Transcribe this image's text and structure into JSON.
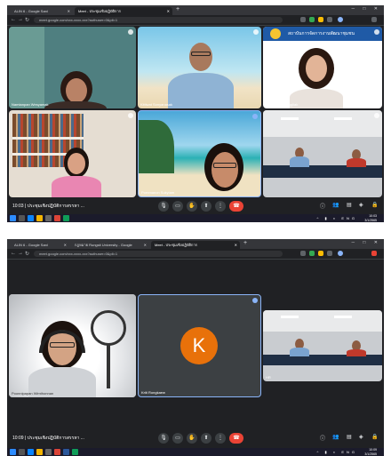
{
  "screenshot_1": {
    "tabs": [
      {
        "label": "ALIN 6 - Google Sanl",
        "active": false
      },
      {
        "label": "Meet - ประชุมเชิงปฏิบัติการ",
        "active": true
      }
    ],
    "url": "meet.google.com/xxx-xxxx-xxx?authuser=0&pli=1",
    "participants": [
      {
        "name": "Namtanpan Wesyamak"
      },
      {
        "name": "Kittiwat Sonyanasak"
      },
      {
        "name": "Pimkamol Konggliak"
      },
      {
        "name": ""
      },
      {
        "name": "Pornmanon Sukyiam"
      },
      {
        "name": ""
      }
    ],
    "banner_text": "สถาบันการจัดการงานพัฒนาชุมชน",
    "meeting_time": "10:03",
    "meeting_title": "ประชุมเชิงปฏิบัติการสรรหา ...",
    "clock": {
      "time": "10:03",
      "date": "3/1/2565"
    }
  },
  "screenshot_2": {
    "tabs": [
      {
        "label": "ALIN 6 - Google Sanl",
        "active": false
      },
      {
        "label": "กฎหมาย Rungsit University - Google",
        "active": false
      },
      {
        "label": "Meet - ประชุมเชิงปฏิบัติการ",
        "active": true
      }
    ],
    "url": "meet.google.com/xxx-xxxx-xxx?authuser=0&pli=1",
    "participants": [
      {
        "name": "Poonnipapan Wimthonnan"
      },
      {
        "name": "Kriti Rongkaew",
        "initial": "K"
      },
      {
        "name": "HR"
      }
    ],
    "meeting_time": "10:09",
    "meeting_title": "ประชุมเชิงปฏิบัติการสรรหา ...",
    "clock": {
      "time": "10:09",
      "date": "3/1/2565"
    }
  },
  "colors": {
    "meet_background": "#202124",
    "end_call": "#ea4335",
    "avatar": "#e8710a",
    "active_speaker_border": "#8ab4f8"
  },
  "icons": [
    "mic-icon",
    "camera-icon",
    "raise-hand-icon",
    "present-icon",
    "more-icon",
    "end-call-icon",
    "info-icon",
    "people-icon",
    "chat-icon",
    "activities-icon",
    "lock-icon"
  ]
}
